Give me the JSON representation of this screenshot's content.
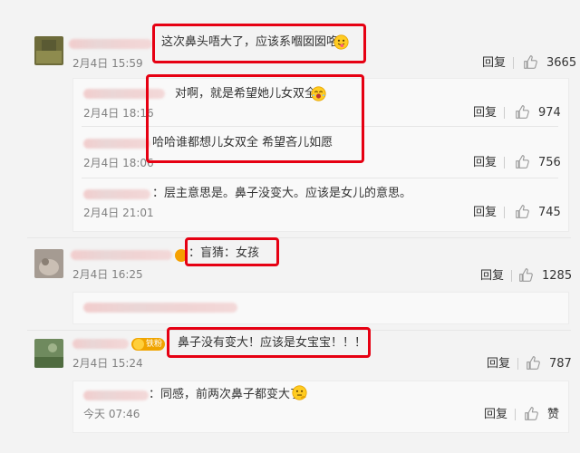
{
  "comments": [
    {
      "text": "这次鼻头唔大了，应该系嗰囡囡咯",
      "time": "2月4日 15:59",
      "reply_label": "回复",
      "likes": "3665",
      "replies": [
        {
          "text": "对啊，就是希望她儿女双全",
          "time": "2月4日 18:16",
          "reply_label": "回复",
          "likes": "974"
        },
        {
          "text": "哈哈谁都想儿女双全  希望吝儿如愿",
          "time": "2月4日 18:06",
          "reply_label": "回复",
          "likes": "756"
        },
        {
          "text": "：层主意思是。鼻子没变大。应该是女儿的意思。",
          "time": "2月4日 21:01",
          "reply_label": "回复",
          "likes": "745"
        }
      ]
    },
    {
      "text": "：盲猜：女孩",
      "time": "2月4日 16:25",
      "reply_label": "回复",
      "likes": "1285",
      "replies": []
    },
    {
      "text": "鼻子没有变大！应该是女宝宝！！！",
      "badge": "铁粉",
      "time": "2月4日 15:24",
      "reply_label": "回复",
      "likes": "787",
      "replies": [
        {
          "text": "：同感，前两次鼻子都变大了",
          "time": "今天 07:46",
          "reply_label": "回复",
          "likes": "赞"
        }
      ]
    }
  ],
  "colors": {
    "highlight": "#e60012",
    "background": "#f3f3f3",
    "subpanel": "#f9f9f9",
    "meta_text": "#808080",
    "badge": "#f0a400"
  },
  "icons": [
    "thumb-up-icon",
    "tongue-out-emoji-icon",
    "laughing-emoji-icon",
    "thinking-emoji-icon",
    "fan-badge-icon"
  ]
}
